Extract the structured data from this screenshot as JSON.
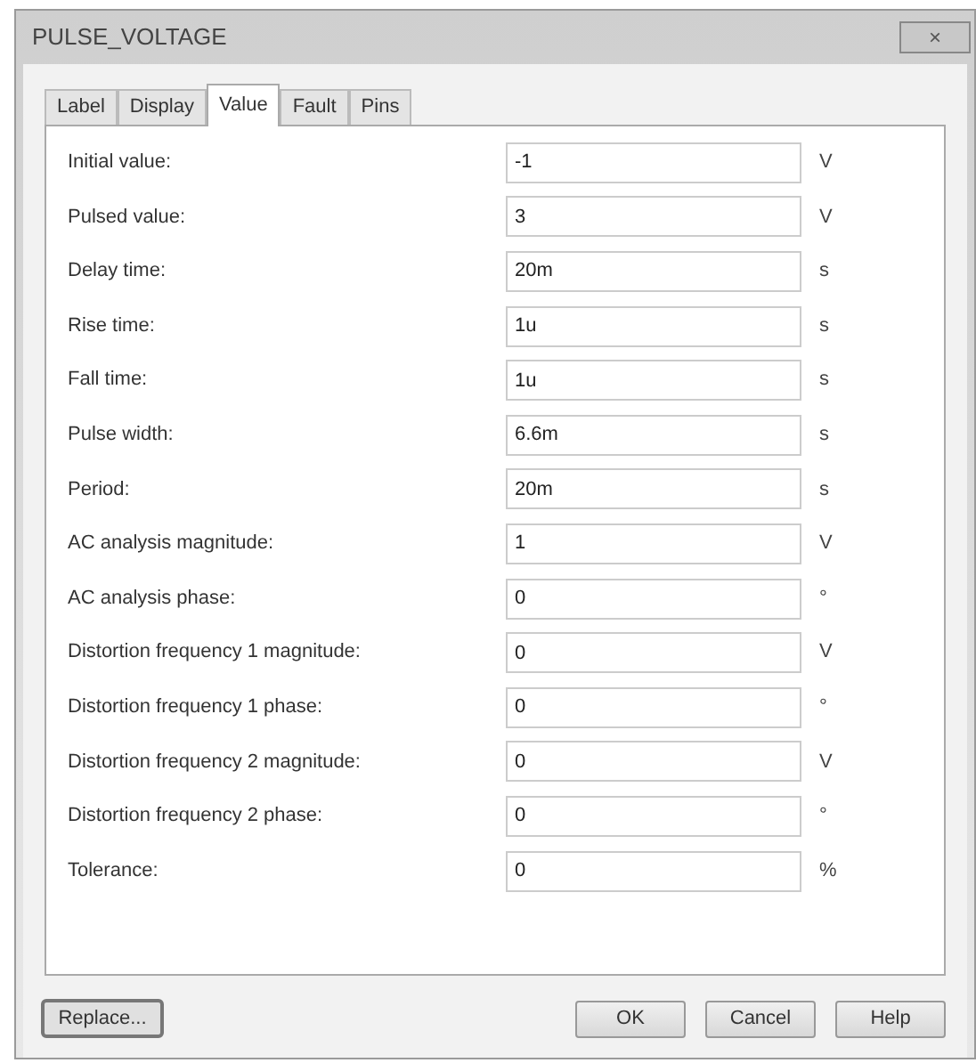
{
  "window": {
    "title": "PULSE_VOLTAGE",
    "close": "×"
  },
  "tabs": [
    {
      "label": "Label",
      "selected": false
    },
    {
      "label": "Display",
      "selected": false
    },
    {
      "label": "Value",
      "selected": true
    },
    {
      "label": "Fault",
      "selected": false
    },
    {
      "label": "Pins",
      "selected": false
    }
  ],
  "fields": [
    {
      "label": "Initial value:",
      "value": "-1",
      "unit": "V"
    },
    {
      "label": "Pulsed value:",
      "value": "3",
      "unit": "V"
    },
    {
      "label": "Delay time:",
      "value": "20m",
      "unit": "s"
    },
    {
      "label": "Rise time:",
      "value": "1u",
      "unit": "s"
    },
    {
      "label": "Fall time:",
      "value": "1u",
      "unit": "s"
    },
    {
      "label": "Pulse width:",
      "value": "6.6m",
      "unit": "s"
    },
    {
      "label": "Period:",
      "value": "20m",
      "unit": "s"
    },
    {
      "label": "AC analysis magnitude:",
      "value": "1",
      "unit": "V"
    },
    {
      "label": "AC analysis phase:",
      "value": "0",
      "unit": "°"
    },
    {
      "label": "Distortion frequency 1 magnitude:",
      "value": "0",
      "unit": "V"
    },
    {
      "label": "Distortion frequency 1 phase:",
      "value": "0",
      "unit": "°"
    },
    {
      "label": "Distortion frequency 2 magnitude:",
      "value": "0",
      "unit": "V"
    },
    {
      "label": "Distortion frequency 2 phase:",
      "value": "0",
      "unit": "°"
    },
    {
      "label": "Tolerance:",
      "value": "0",
      "unit": "%"
    }
  ],
  "buttons": {
    "left": [
      "Replace..."
    ],
    "right": [
      "OK",
      "Cancel",
      "Help"
    ]
  }
}
